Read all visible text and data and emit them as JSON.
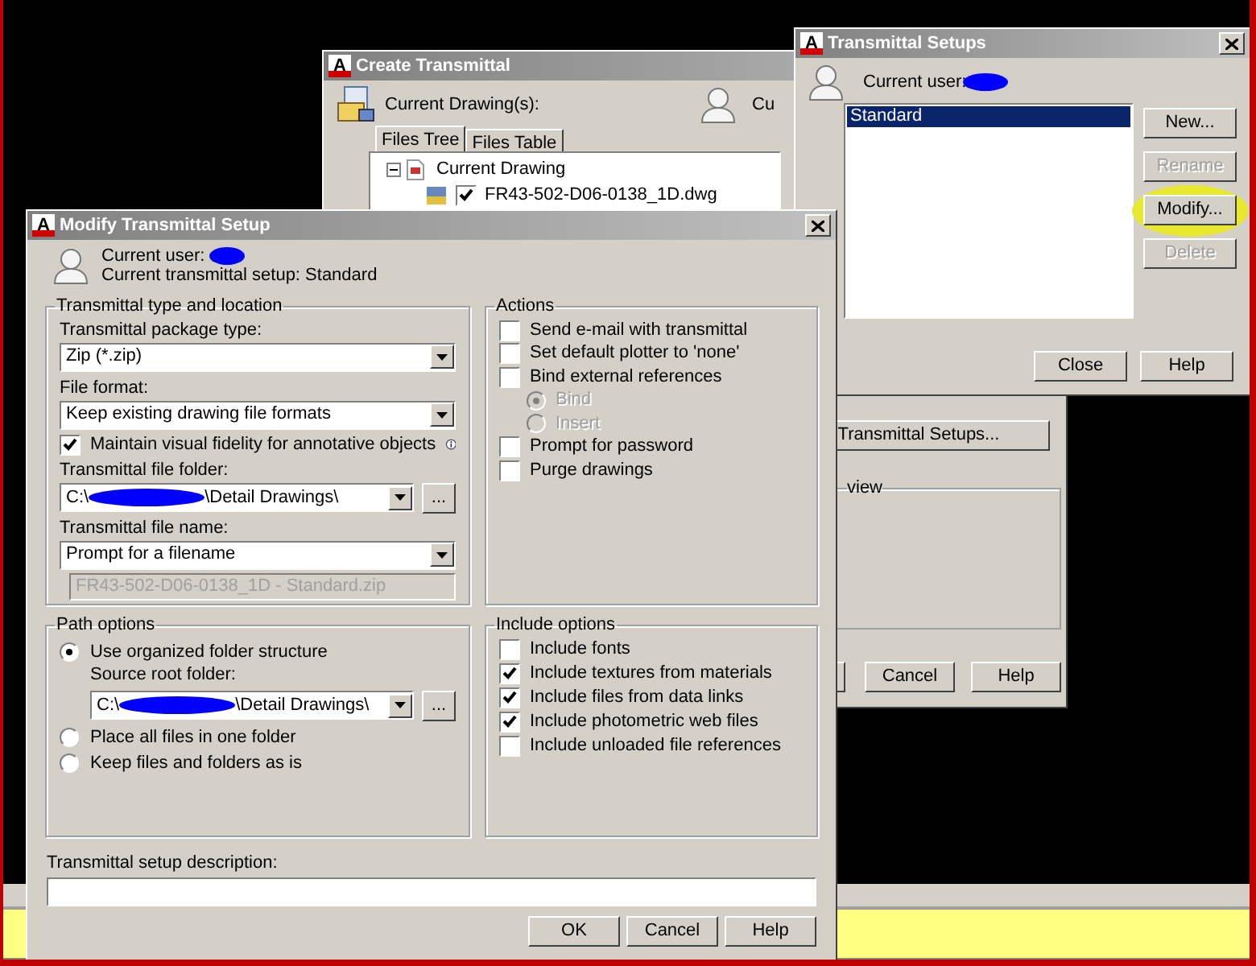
{
  "create_transmittal": {
    "logo": "A",
    "title": "Create Transmittal",
    "current_drawings_label": "Current Drawing(s):",
    "user_label": "Cu",
    "tabs": [
      {
        "label": "Files Tree",
        "selected": true
      },
      {
        "label": "Files Table",
        "selected": false
      }
    ],
    "tree": [
      {
        "label": "Current Drawing",
        "expanded": true,
        "children": [
          {
            "label": "FR43-502-D06-0138_1D.dwg",
            "checked": true
          }
        ]
      }
    ],
    "setups_button": "Transmittal Setups...",
    "preview_label": "view",
    "buttons": [
      "Cancel",
      "Help"
    ]
  },
  "transmittal_setups": {
    "logo": "A",
    "title": "Transmittal Setups",
    "current_user_label": "Current user:",
    "setups": [
      {
        "label": "Standard",
        "selected": true
      }
    ],
    "buttons": [
      {
        "label": "New...",
        "disabled": false,
        "highlighted": false
      },
      {
        "label": "Rename",
        "disabled": true,
        "highlighted": false
      },
      {
        "label": "Modify...",
        "disabled": false,
        "highlighted": true
      },
      {
        "label": "Delete",
        "disabled": true,
        "highlighted": false
      }
    ],
    "footer_buttons": [
      "Close",
      "Help"
    ]
  },
  "modify_setup": {
    "logo": "A",
    "title": "Modify Transmittal Setup",
    "current_user_label": "Current user:",
    "current_setup": "Current transmittal setup: Standard",
    "type_group": {
      "title": "Transmittal type and location",
      "package_type": {
        "label": "Transmittal package type:",
        "value": "Zip (*.zip)"
      },
      "file_format": {
        "label": "File format:",
        "value": "Keep existing drawing file formats"
      },
      "fidelity": {
        "label": "Maintain visual fidelity for annotative objects",
        "checked": true
      },
      "file_folder": {
        "label": "Transmittal file folder:",
        "value_start": "C:\\",
        "value_end": "\\Detail Drawings\\",
        "browse": "..."
      },
      "file_name": {
        "label": "Transmittal file name:",
        "value": "Prompt for a filename"
      },
      "file_name_preview": "FR43-502-D06-0138_1D - Standard.zip"
    },
    "actions": {
      "title": "Actions",
      "items": [
        {
          "kind": "checkbox",
          "label": "Send e-mail with transmittal",
          "checked": false,
          "disabled": false
        },
        {
          "kind": "checkbox",
          "label": "Set default plotter to 'none'",
          "checked": false,
          "disabled": false
        },
        {
          "kind": "checkbox",
          "label": "Bind external references",
          "checked": false,
          "disabled": false
        },
        {
          "kind": "radio",
          "label": "Bind",
          "checked": true,
          "disabled": true
        },
        {
          "kind": "radio",
          "label": "Insert",
          "checked": false,
          "disabled": true
        },
        {
          "kind": "checkbox",
          "label": "Prompt for password",
          "checked": false,
          "disabled": false
        },
        {
          "kind": "checkbox",
          "label": "Purge drawings",
          "checked": false,
          "disabled": false
        }
      ]
    },
    "path_options": {
      "title": "Path options",
      "options": [
        {
          "label": "Use organized folder structure",
          "selected": true
        },
        {
          "label": "Place all files in one folder",
          "selected": false
        },
        {
          "label": "Keep files and folders as is",
          "selected": false
        }
      ],
      "source_root": {
        "label": "Source root folder:",
        "value_start": "C:\\",
        "value_end": "\\Detail Drawings\\",
        "browse": "..."
      }
    },
    "include_options": {
      "title": "Include options",
      "items": [
        {
          "label": "Include fonts",
          "checked": false
        },
        {
          "label": "Include textures from materials",
          "checked": true
        },
        {
          "label": "Include files from data links",
          "checked": true
        },
        {
          "label": "Include photometric web files",
          "checked": true
        },
        {
          "label": "Include unloaded file references",
          "checked": false
        }
      ]
    },
    "description_label": "Transmittal setup description:",
    "buttons": [
      "OK",
      "Cancel",
      "Help"
    ]
  }
}
